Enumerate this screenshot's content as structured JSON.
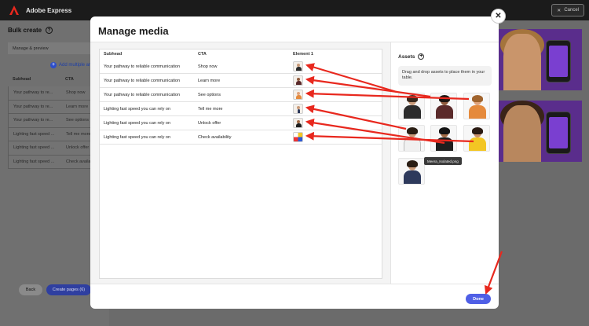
{
  "app": {
    "title": "Adobe Express",
    "cancel_label": "Cancel"
  },
  "left_panel": {
    "title": "Bulk create",
    "tab_label": "Manage & preview",
    "add_multiple_label": "Add multiple ar",
    "columns": [
      "Subhead",
      "CTA"
    ],
    "rows": [
      {
        "subhead": "Your pathway to re...",
        "cta": "Shop now"
      },
      {
        "subhead": "Your pathway to re...",
        "cta": "Learn more"
      },
      {
        "subhead": "Your pathway to re...",
        "cta": "See options"
      },
      {
        "subhead": "Lighting fast speed ...",
        "cta": "Tell me more"
      },
      {
        "subhead": "Lighting fast speed ...",
        "cta": "Unlock offer"
      },
      {
        "subhead": "Lighting fast speed ...",
        "cta": "Check availab"
      }
    ],
    "back_label": "Back",
    "create_label": "Create pages (6)"
  },
  "modal": {
    "title": "Manage media",
    "columns": [
      "Subhead",
      "CTA",
      "Element 1"
    ],
    "rows": [
      {
        "subhead": "Your pathway to reliable communication",
        "cta": "Shop now"
      },
      {
        "subhead": "Your pathway to reliable communication",
        "cta": "Learn more"
      },
      {
        "subhead": "Your pathway to reliable communication",
        "cta": "See options"
      },
      {
        "subhead": "Lighting fast speed you can rely on",
        "cta": "Tell me more"
      },
      {
        "subhead": "Lighting fast speed you can rely on",
        "cta": "Unlock offer"
      },
      {
        "subhead": "Lighting fast speed you can rely on",
        "cta": "Check availability"
      }
    ],
    "assets": {
      "title": "Assets",
      "hint": "Drag and drop assets to place them in your table.",
      "tooltip": "Meera_Isolated.png"
    },
    "done_label": "Done"
  },
  "colors": {
    "accent": "#4f5fe6",
    "annotation": "#e8281e",
    "preview_purple": "#5a2d8c"
  }
}
